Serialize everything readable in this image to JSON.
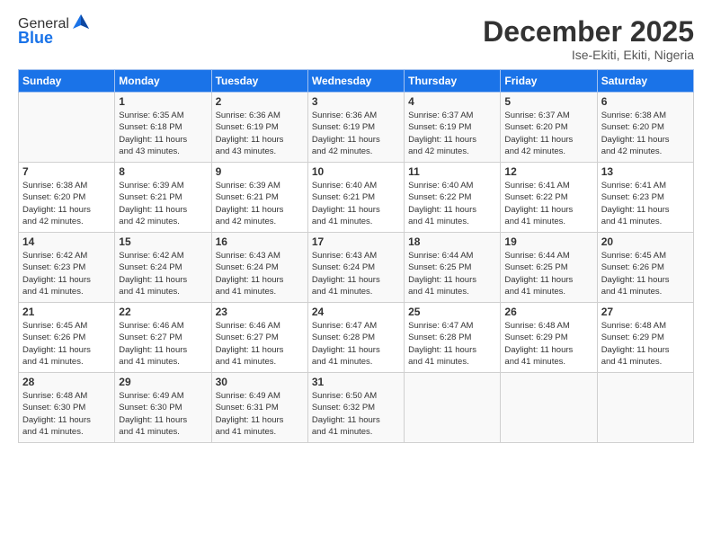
{
  "header": {
    "logo_line1": "General",
    "logo_line2": "Blue",
    "month": "December 2025",
    "location": "Ise-Ekiti, Ekiti, Nigeria"
  },
  "weekdays": [
    "Sunday",
    "Monday",
    "Tuesday",
    "Wednesday",
    "Thursday",
    "Friday",
    "Saturday"
  ],
  "weeks": [
    [
      {
        "day": "",
        "info": ""
      },
      {
        "day": "1",
        "info": "Sunrise: 6:35 AM\nSunset: 6:18 PM\nDaylight: 11 hours\nand 43 minutes."
      },
      {
        "day": "2",
        "info": "Sunrise: 6:36 AM\nSunset: 6:19 PM\nDaylight: 11 hours\nand 43 minutes."
      },
      {
        "day": "3",
        "info": "Sunrise: 6:36 AM\nSunset: 6:19 PM\nDaylight: 11 hours\nand 42 minutes."
      },
      {
        "day": "4",
        "info": "Sunrise: 6:37 AM\nSunset: 6:19 PM\nDaylight: 11 hours\nand 42 minutes."
      },
      {
        "day": "5",
        "info": "Sunrise: 6:37 AM\nSunset: 6:20 PM\nDaylight: 11 hours\nand 42 minutes."
      },
      {
        "day": "6",
        "info": "Sunrise: 6:38 AM\nSunset: 6:20 PM\nDaylight: 11 hours\nand 42 minutes."
      }
    ],
    [
      {
        "day": "7",
        "info": "Sunrise: 6:38 AM\nSunset: 6:20 PM\nDaylight: 11 hours\nand 42 minutes."
      },
      {
        "day": "8",
        "info": "Sunrise: 6:39 AM\nSunset: 6:21 PM\nDaylight: 11 hours\nand 42 minutes."
      },
      {
        "day": "9",
        "info": "Sunrise: 6:39 AM\nSunset: 6:21 PM\nDaylight: 11 hours\nand 42 minutes."
      },
      {
        "day": "10",
        "info": "Sunrise: 6:40 AM\nSunset: 6:21 PM\nDaylight: 11 hours\nand 41 minutes."
      },
      {
        "day": "11",
        "info": "Sunrise: 6:40 AM\nSunset: 6:22 PM\nDaylight: 11 hours\nand 41 minutes."
      },
      {
        "day": "12",
        "info": "Sunrise: 6:41 AM\nSunset: 6:22 PM\nDaylight: 11 hours\nand 41 minutes."
      },
      {
        "day": "13",
        "info": "Sunrise: 6:41 AM\nSunset: 6:23 PM\nDaylight: 11 hours\nand 41 minutes."
      }
    ],
    [
      {
        "day": "14",
        "info": "Sunrise: 6:42 AM\nSunset: 6:23 PM\nDaylight: 11 hours\nand 41 minutes."
      },
      {
        "day": "15",
        "info": "Sunrise: 6:42 AM\nSunset: 6:24 PM\nDaylight: 11 hours\nand 41 minutes."
      },
      {
        "day": "16",
        "info": "Sunrise: 6:43 AM\nSunset: 6:24 PM\nDaylight: 11 hours\nand 41 minutes."
      },
      {
        "day": "17",
        "info": "Sunrise: 6:43 AM\nSunset: 6:24 PM\nDaylight: 11 hours\nand 41 minutes."
      },
      {
        "day": "18",
        "info": "Sunrise: 6:44 AM\nSunset: 6:25 PM\nDaylight: 11 hours\nand 41 minutes."
      },
      {
        "day": "19",
        "info": "Sunrise: 6:44 AM\nSunset: 6:25 PM\nDaylight: 11 hours\nand 41 minutes."
      },
      {
        "day": "20",
        "info": "Sunrise: 6:45 AM\nSunset: 6:26 PM\nDaylight: 11 hours\nand 41 minutes."
      }
    ],
    [
      {
        "day": "21",
        "info": "Sunrise: 6:45 AM\nSunset: 6:26 PM\nDaylight: 11 hours\nand 41 minutes."
      },
      {
        "day": "22",
        "info": "Sunrise: 6:46 AM\nSunset: 6:27 PM\nDaylight: 11 hours\nand 41 minutes."
      },
      {
        "day": "23",
        "info": "Sunrise: 6:46 AM\nSunset: 6:27 PM\nDaylight: 11 hours\nand 41 minutes."
      },
      {
        "day": "24",
        "info": "Sunrise: 6:47 AM\nSunset: 6:28 PM\nDaylight: 11 hours\nand 41 minutes."
      },
      {
        "day": "25",
        "info": "Sunrise: 6:47 AM\nSunset: 6:28 PM\nDaylight: 11 hours\nand 41 minutes."
      },
      {
        "day": "26",
        "info": "Sunrise: 6:48 AM\nSunset: 6:29 PM\nDaylight: 11 hours\nand 41 minutes."
      },
      {
        "day": "27",
        "info": "Sunrise: 6:48 AM\nSunset: 6:29 PM\nDaylight: 11 hours\nand 41 minutes."
      }
    ],
    [
      {
        "day": "28",
        "info": "Sunrise: 6:48 AM\nSunset: 6:30 PM\nDaylight: 11 hours\nand 41 minutes."
      },
      {
        "day": "29",
        "info": "Sunrise: 6:49 AM\nSunset: 6:30 PM\nDaylight: 11 hours\nand 41 minutes."
      },
      {
        "day": "30",
        "info": "Sunrise: 6:49 AM\nSunset: 6:31 PM\nDaylight: 11 hours\nand 41 minutes."
      },
      {
        "day": "31",
        "info": "Sunrise: 6:50 AM\nSunset: 6:32 PM\nDaylight: 11 hours\nand 41 minutes."
      },
      {
        "day": "",
        "info": ""
      },
      {
        "day": "",
        "info": ""
      },
      {
        "day": "",
        "info": ""
      }
    ]
  ]
}
